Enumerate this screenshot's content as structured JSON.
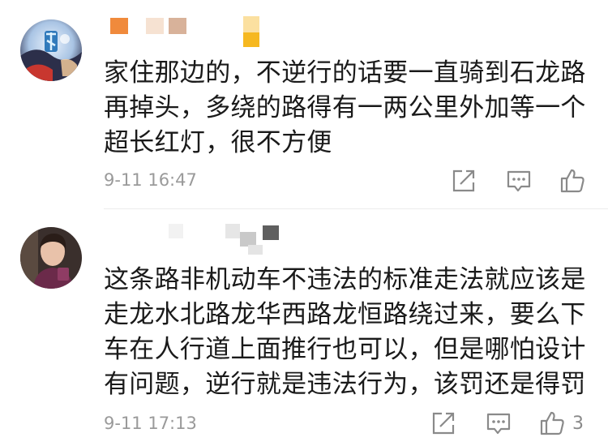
{
  "comments": [
    {
      "text_lines": [
        "家住那边的，不逆行的话要一直骑到石龙路",
        "再掉头，多绕的路得有一两公里外加等一个",
        "超长红灯，很不方便"
      ],
      "time": "9-11 16:47",
      "like_count": "",
      "icons": {
        "share": "share-icon",
        "reply": "comment-icon",
        "like": "thumbs-up-icon"
      }
    },
    {
      "text_lines": [
        "这条路非机动车不违法的标准走法就应该是",
        "走龙水北路龙华西路龙恒路绕过来，要么下",
        "车在人行道上面推行也可以，但是哪怕设计",
        "有问题，逆行就是违法行为，该罚还是得罚"
      ],
      "time": "9-11 17:13",
      "like_count": "3",
      "icons": {
        "share": "share-icon",
        "reply": "comment-icon",
        "like": "thumbs-up-icon"
      }
    }
  ],
  "colors": {
    "text": "#1a1a1a",
    "meta": "#9a9a9a",
    "icon": "#8a8a8a",
    "divider": "#ececec",
    "name_blocks_1": [
      "#f08a3c",
      "#f6e2d2",
      "#d8b29a",
      "#fbe0a0",
      "#f6b820"
    ],
    "name_blocks_2": [
      "#e6e6e6",
      "#c9c9c9",
      "#8f8f8f",
      "#5f5f5f",
      "#f0f0f0"
    ]
  }
}
